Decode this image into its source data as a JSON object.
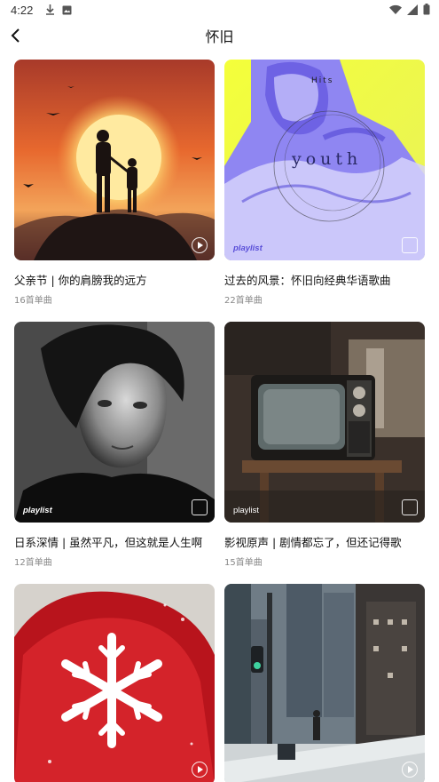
{
  "status_bar": {
    "time": "4:22",
    "left_icons": [
      "download-icon",
      "photo-icon"
    ],
    "right_icons": [
      "wifi-icon",
      "signal-icon",
      "battery-icon"
    ]
  },
  "header": {
    "back_icon": "chevron-left-icon",
    "title": "怀旧"
  },
  "cards": [
    {
      "title": "父亲节 | 你的肩膀我的远方",
      "count": "16首单曲",
      "badge": "play",
      "playlist_label": ""
    },
    {
      "title": "过去的风景：怀旧向经典华语歌曲",
      "count": "22首单曲",
      "badge": "playlist",
      "playlist_label": "playlist",
      "cover_text_top": "Hits",
      "cover_text_main": "youth"
    },
    {
      "title": "日系深情 | 虽然平凡，但这就是人生啊",
      "count": "12首单曲",
      "badge": "playlist",
      "playlist_label": "playlist"
    },
    {
      "title": "影视原声 | 剧情都忘了，但还记得歌",
      "count": "15首单曲",
      "badge": "playlist",
      "playlist_label": "playlist"
    },
    {
      "title": "",
      "count": "",
      "badge": "play",
      "playlist_label": ""
    },
    {
      "title": "",
      "count": "",
      "badge": "play",
      "playlist_label": ""
    }
  ],
  "colors": {
    "accent": "#111111",
    "muted_text": "#888888",
    "background": "#ffffff"
  }
}
